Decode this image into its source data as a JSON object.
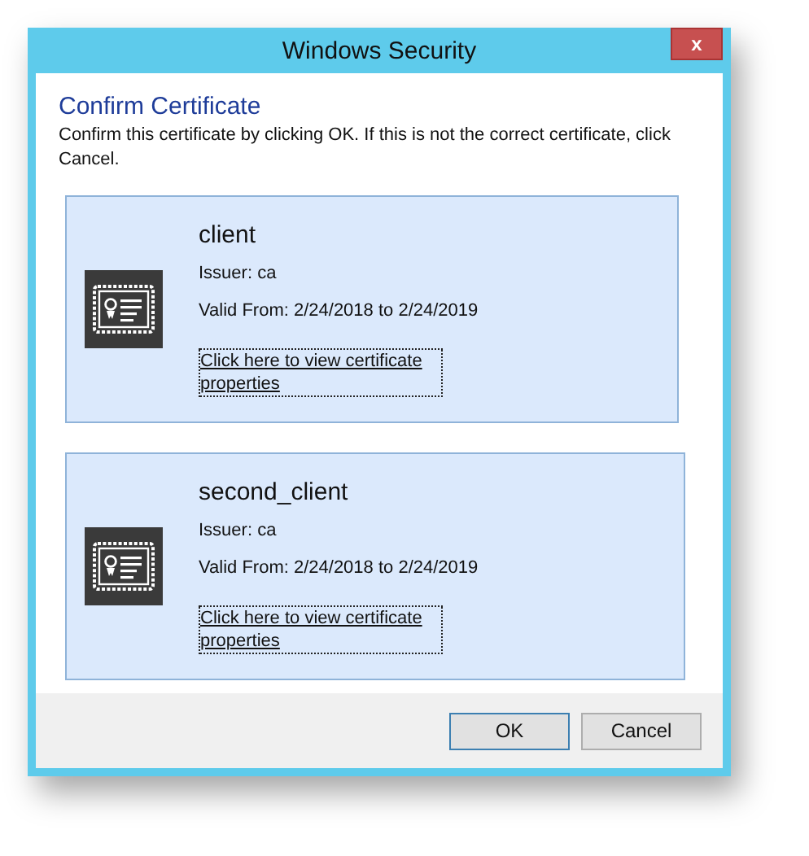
{
  "window": {
    "title": "Windows Security",
    "close": "x"
  },
  "heading": "Confirm Certificate",
  "message": "Confirm this certificate by clicking OK. If this is not the correct certificate, click Cancel.",
  "certificates": [
    {
      "name": "client",
      "issuer": "Issuer: ca",
      "valid": "Valid From: 2/24/2018 to 2/24/2019",
      "link": "Click here to view certificate properties"
    },
    {
      "name": "second_client",
      "issuer": "Issuer: ca",
      "valid": "Valid From: 2/24/2018 to 2/24/2019",
      "link": "Click here to view certificate properties"
    }
  ],
  "buttons": [
    "OK",
    "Cancel"
  ]
}
